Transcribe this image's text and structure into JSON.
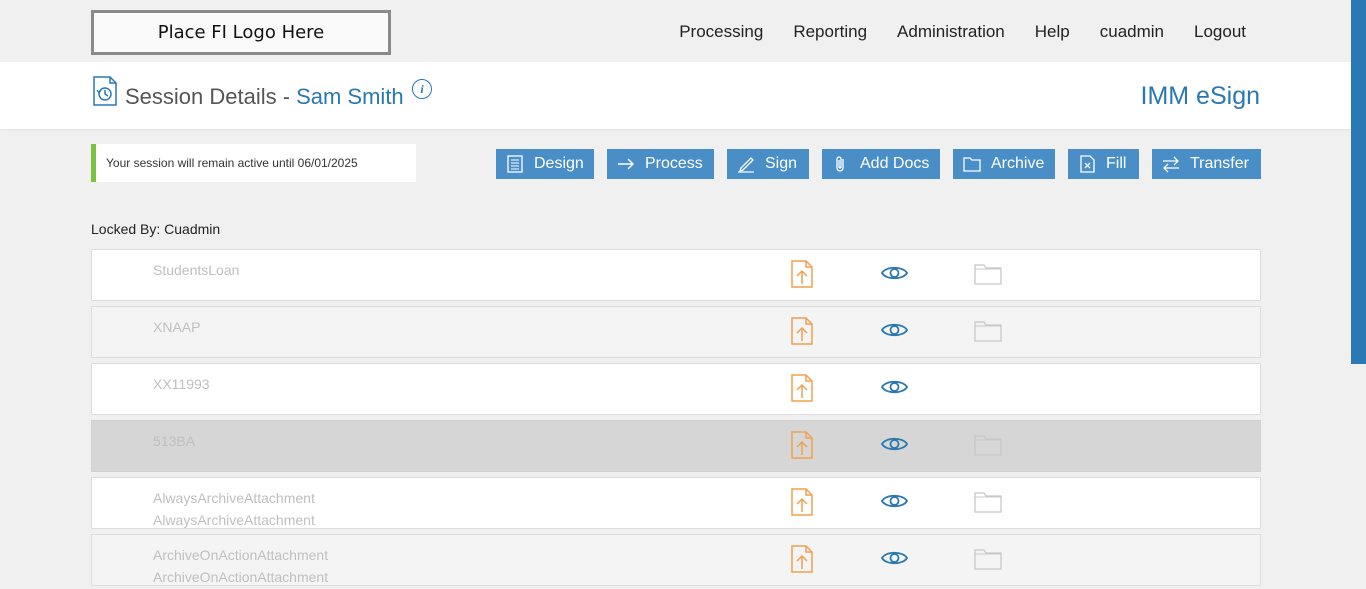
{
  "logo": {
    "text": "Place FI Logo Here"
  },
  "nav": {
    "items": [
      "Processing",
      "Reporting",
      "Administration",
      "Help",
      "cuadmin",
      "Logout"
    ]
  },
  "header": {
    "title": "Session Details -",
    "customer": "Sam Smith",
    "brand": "IMM eSign"
  },
  "notice": {
    "text": "Your session will remain active until 06/01/2025",
    "accent": "#7cc142"
  },
  "toolbar": {
    "buttons": [
      {
        "label": "Design",
        "icon": "design-icon"
      },
      {
        "label": "Process",
        "icon": "arrow-right-icon"
      },
      {
        "label": "Sign",
        "icon": "pen-icon"
      },
      {
        "label": "Add Docs",
        "icon": "paperclip-icon"
      },
      {
        "label": "Archive",
        "icon": "folder-icon"
      },
      {
        "label": "Fill",
        "icon": "fill-doc-icon"
      },
      {
        "label": "Transfer",
        "icon": "transfer-icon"
      }
    ]
  },
  "locked_by": "Locked By: Cuadmin",
  "documents": [
    {
      "name": "StudentsLoan",
      "subname": "",
      "archive_folder": true
    },
    {
      "name": "XNAAP",
      "subname": "",
      "archive_folder": true
    },
    {
      "name": "XX11993",
      "subname": "",
      "archive_folder": false
    },
    {
      "name": "513BA",
      "subname": "",
      "archive_folder": true,
      "selected": true
    },
    {
      "name": "AlwaysArchiveAttachment",
      "subname": "AlwaysArchiveAttachment",
      "archive_folder": true
    },
    {
      "name": "ArchiveOnActionAttachment",
      "subname": "ArchiveOnActionAttachment",
      "archive_folder": true
    }
  ],
  "colors": {
    "brand_blue": "#2a78b0",
    "button_blue": "#4a8ec7",
    "upload_orange": "#f0a050",
    "scroll_thumb": "#2b78b4"
  }
}
